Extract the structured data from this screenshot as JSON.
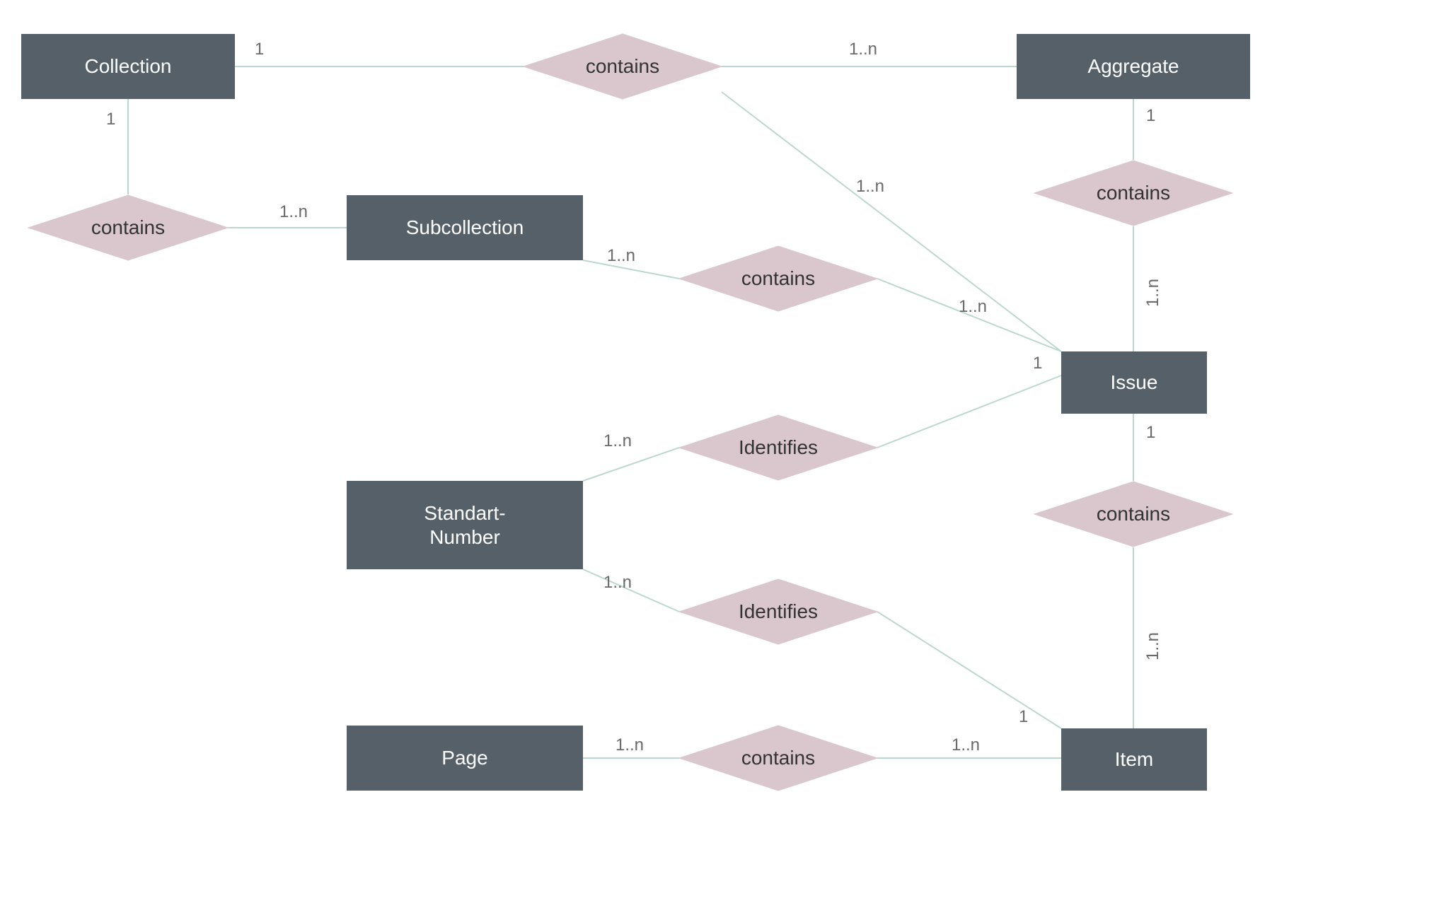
{
  "colors": {
    "entityFill": "#556068",
    "relFill": "#D9C7CD",
    "relStroke": "#D9C7CD",
    "edge": "#BBD8CE",
    "text": "#FFFFFF",
    "cardText": "#6A6A6A"
  },
  "entities": {
    "collection": {
      "label": "Collection"
    },
    "subcollection": {
      "label": "Subcollection"
    },
    "aggregate": {
      "label": "Aggregate"
    },
    "issue": {
      "label": "Issue"
    },
    "standartNumber": {
      "label": "Standart-\nNumber"
    },
    "page": {
      "label": "Page"
    },
    "item": {
      "label": "Item"
    }
  },
  "relationships": {
    "contains1": {
      "label": "contains"
    },
    "contains2": {
      "label": "contains"
    },
    "contains3": {
      "label": "contains"
    },
    "contains4": {
      "label": "contains"
    },
    "contains5": {
      "label": "contains"
    },
    "contains6": {
      "label": "contains"
    },
    "identifies1": {
      "label": "Identifies"
    },
    "identifies2": {
      "label": "Identifies"
    }
  },
  "cardinalities": {
    "coll_to_contains1": "1",
    "contains1_to_agg": "1..n",
    "coll_to_contains2": "1",
    "contains2_to_subcoll": "1..n",
    "subcoll_to_contains3": "1..n",
    "contains3_to_issue_a": "1..n",
    "contains1_to_issue_diag": "1..n",
    "agg_to_contains4": "1",
    "contains4_to_issue": "1..n",
    "issue_to_identifies1": "1",
    "identifies1_to_std": "1..n",
    "std_to_identifies2": "1..n",
    "identifies2_to_item": "1",
    "issue_to_contains5": "1",
    "contains5_to_item": "1..n",
    "item_to_contains6": "1..n",
    "contains6_to_page": "1..n"
  }
}
